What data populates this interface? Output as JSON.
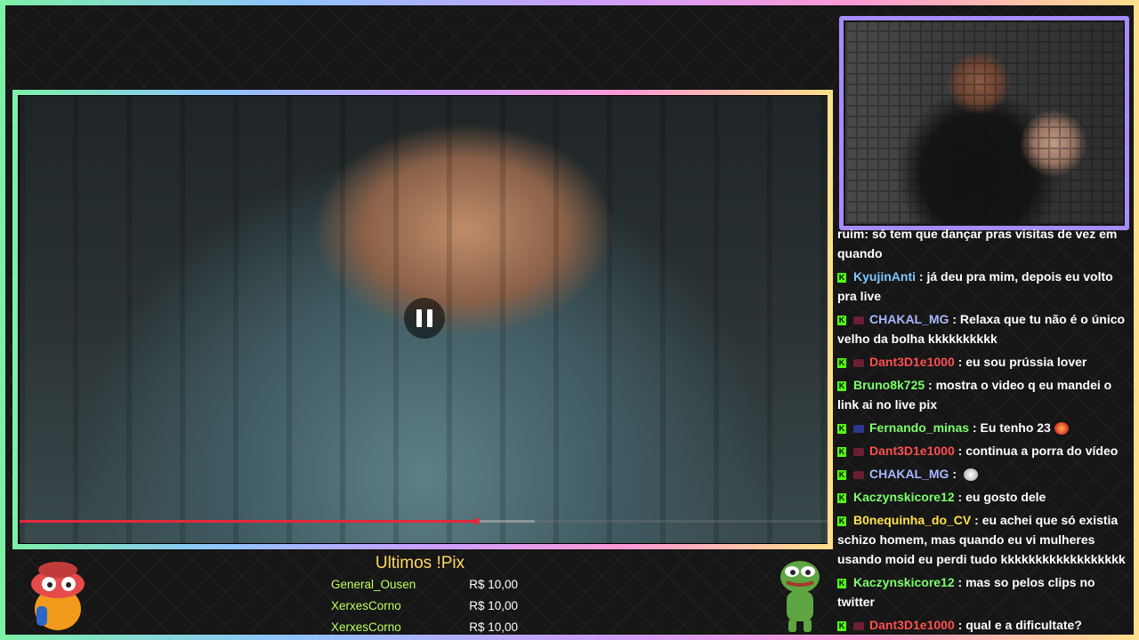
{
  "video": {
    "progress_percent": 56.5,
    "buffered_percent": 63.8
  },
  "pix": {
    "title": "Ultimos !Pix",
    "rows": [
      {
        "user": "General_Ousen",
        "amount": "R$ 10,00"
      },
      {
        "user": "XerxesCorno",
        "amount": "R$ 10,00"
      },
      {
        "user": "XerxesCorno",
        "amount": "R$ 10,00"
      }
    ]
  },
  "chat": {
    "messages": [
      {
        "user": "",
        "text": "ruim: só tem que dançar pras visitas de vez em quando"
      },
      {
        "user": "KyujinAnti",
        "user_color": "#7ec6ff",
        "text": "já deu pra mim, depois eu volto pra live"
      },
      {
        "user": "CHAKAL_MG",
        "user_color": "#a7b8ff",
        "text": "Relaxa que tu não é o único velho da bolha kkkkkkkkkk"
      },
      {
        "user": "Dant3D1e1000",
        "user_color": "#ff4f4f",
        "text": "eu sou prússia lover"
      },
      {
        "user": "Bruno8k725",
        "user_color": "#7dff6b",
        "text": "mostra o video q eu mandei o link ai no live pix"
      },
      {
        "user": "Fernando_minas",
        "user_color": "#7dff6b",
        "text": "Eu tenho 23"
      },
      {
        "user": "Dant3D1e1000",
        "user_color": "#ff4f4f",
        "text": "continua a porra do vídeo"
      },
      {
        "user": "CHAKAL_MG",
        "user_color": "#a7b8ff",
        "text": ""
      },
      {
        "user": "Kaczynskicore12",
        "user_color": "#7dff6b",
        "text": "eu gosto dele"
      },
      {
        "user": "B0nequinha_do_CV",
        "user_color": "#ffe14f",
        "text": "eu achei que só existia schizo homem, mas quando eu vi mulheres usando moid eu perdi tudo kkkkkkkkkkkkkkkkkk"
      },
      {
        "user": "Kaczynskicore12",
        "user_color": "#7dff6b",
        "text": "mas so pelos clips no twitter"
      },
      {
        "user": "Dant3D1e1000",
        "user_color": "#ff4f4f",
        "text": "qual e a dificultate?"
      }
    ]
  },
  "icons": {
    "pause": "pause-icon",
    "kick": "kick-badge-icon"
  }
}
